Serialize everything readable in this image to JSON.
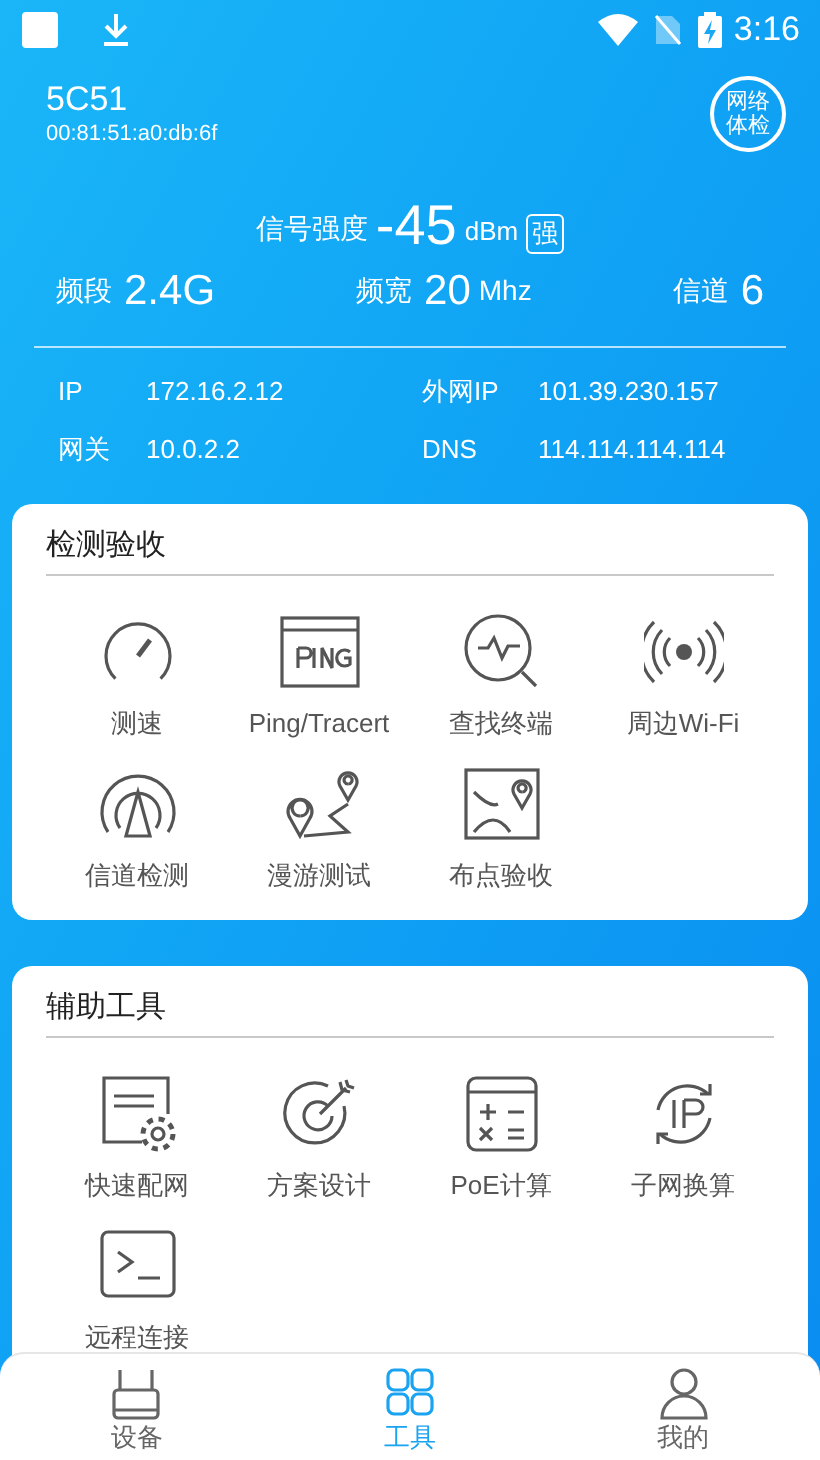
{
  "status_bar": {
    "time": "3:16"
  },
  "header": {
    "ssid": "5C51",
    "mac": "00:81:51:a0:db:6f",
    "check_button": "网络体检",
    "signal": {
      "label": "信号强度",
      "value": "-45",
      "unit": "dBm",
      "badge": "强"
    },
    "stats": [
      {
        "label": "频段",
        "value": "2.4G"
      },
      {
        "label": "频宽",
        "value": "20",
        "unit": "Mhz"
      },
      {
        "label": "信道",
        "value": "6"
      }
    ],
    "info": [
      {
        "label": "IP",
        "value": "172.16.2.12"
      },
      {
        "label": "外网IP",
        "value": "101.39.230.157"
      },
      {
        "label": "网关",
        "value": "10.0.2.2"
      },
      {
        "label": "DNS",
        "value": "114.114.114.114"
      }
    ]
  },
  "sections": [
    {
      "title": "检测验收",
      "tools": [
        {
          "label": "测速",
          "kind": "gauge"
        },
        {
          "label": "Ping/Tracert",
          "kind": "ping"
        },
        {
          "label": "查找终端",
          "kind": "pulse"
        },
        {
          "label": "周边Wi-Fi",
          "kind": "waves"
        },
        {
          "label": "信道检测",
          "kind": "channel"
        },
        {
          "label": "漫游测试",
          "kind": "route"
        },
        {
          "label": "布点验收",
          "kind": "map"
        }
      ]
    },
    {
      "title": "辅助工具",
      "tools": [
        {
          "label": "快速配网",
          "kind": "config"
        },
        {
          "label": "方案设计",
          "kind": "target"
        },
        {
          "label": "PoE计算",
          "kind": "calc"
        },
        {
          "label": "子网换算",
          "kind": "ip"
        },
        {
          "label": "远程连接",
          "kind": "terminal"
        }
      ]
    }
  ],
  "nav": [
    {
      "label": "设备",
      "kind": "router",
      "selected": false
    },
    {
      "label": "工具",
      "kind": "grid",
      "selected": true
    },
    {
      "label": "我的",
      "kind": "person",
      "selected": false
    }
  ]
}
